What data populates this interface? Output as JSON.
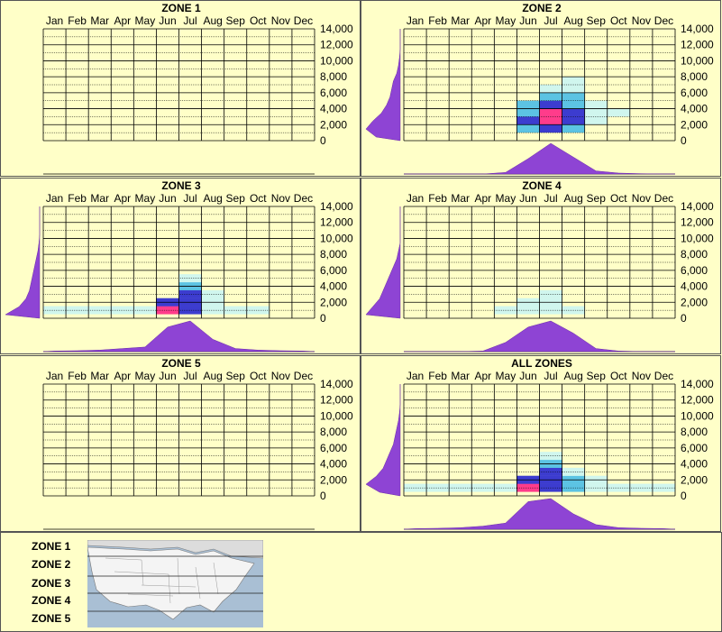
{
  "months": [
    "Jan",
    "Feb",
    "Mar",
    "Apr",
    "May",
    "Jun",
    "Jul",
    "Aug",
    "Sep",
    "Oct",
    "Nov",
    "Dec"
  ],
  "yticks": [
    "14,000",
    "12,000",
    "10,000",
    "8,000",
    "6,000",
    "4,000",
    "2,000",
    "0"
  ],
  "colors": {
    "background": "#ffffc8",
    "profile": "#8e44d4",
    "heat_low": "#c8f5f5",
    "heat_mid": "#40b8e8",
    "heat_high": "#1a1ad0",
    "heat_peak": "#ff1a80"
  },
  "chart_data": [
    {
      "type": "heatmap",
      "title": "ZONE 1",
      "x": [
        "Jan",
        "Feb",
        "Mar",
        "Apr",
        "May",
        "Jun",
        "Jul",
        "Aug",
        "Sep",
        "Oct",
        "Nov",
        "Dec"
      ],
      "ylim": [
        0,
        14000
      ],
      "cells": [],
      "month_profile": [
        0,
        0,
        0,
        0,
        0,
        0,
        0,
        0,
        0,
        0,
        0,
        0
      ],
      "elev_profile": [
        0,
        0,
        0,
        0,
        0,
        0,
        0,
        0,
        0,
        0,
        0,
        0,
        0,
        0
      ]
    },
    {
      "type": "heatmap",
      "title": "ZONE 2",
      "x": [
        "Jan",
        "Feb",
        "Mar",
        "Apr",
        "May",
        "Jun",
        "Jul",
        "Aug",
        "Sep",
        "Oct",
        "Nov",
        "Dec"
      ],
      "ylim": [
        0,
        14000
      ],
      "cells": [
        [
          5,
          1000,
          0.5
        ],
        [
          5,
          2000,
          0.7
        ],
        [
          5,
          3000,
          0.6
        ],
        [
          5,
          4000,
          0.4
        ],
        [
          6,
          1000,
          0.9
        ],
        [
          6,
          2000,
          1.0
        ],
        [
          6,
          3000,
          0.95
        ],
        [
          6,
          4000,
          0.7
        ],
        [
          6,
          5000,
          0.5
        ],
        [
          6,
          6000,
          0.3
        ],
        [
          7,
          1000,
          0.6
        ],
        [
          7,
          2000,
          0.8
        ],
        [
          7,
          3000,
          0.75
        ],
        [
          7,
          4000,
          0.6
        ],
        [
          7,
          5000,
          0.4
        ],
        [
          7,
          6000,
          0.3
        ],
        [
          7,
          7000,
          0.2
        ],
        [
          8,
          2000,
          0.25
        ],
        [
          8,
          3000,
          0.25
        ],
        [
          8,
          4000,
          0.2
        ],
        [
          9,
          3000,
          0.1
        ]
      ],
      "month_profile": [
        0,
        0,
        0,
        0,
        0.05,
        0.5,
        1.0,
        0.55,
        0.1,
        0.03,
        0.01,
        0
      ],
      "elev_profile": [
        0.7,
        1.0,
        0.8,
        0.55,
        0.4,
        0.3,
        0.25,
        0.2,
        0.1,
        0.05,
        0.02,
        0,
        0,
        0
      ]
    },
    {
      "type": "heatmap",
      "title": "ZONE 3",
      "x": [
        "Jan",
        "Feb",
        "Mar",
        "Apr",
        "May",
        "Jun",
        "Jul",
        "Aug",
        "Sep",
        "Oct",
        "Nov",
        "Dec"
      ],
      "ylim": [
        0,
        14000
      ],
      "cells": [
        [
          0,
          500,
          0.1
        ],
        [
          1,
          500,
          0.1
        ],
        [
          2,
          500,
          0.1
        ],
        [
          3,
          500,
          0.12
        ],
        [
          4,
          500,
          0.2
        ],
        [
          5,
          500,
          1.0
        ],
        [
          5,
          1500,
          0.7
        ],
        [
          6,
          500,
          0.7
        ],
        [
          6,
          1500,
          0.8
        ],
        [
          6,
          2500,
          0.7
        ],
        [
          6,
          3500,
          0.5
        ],
        [
          6,
          4500,
          0.3
        ],
        [
          7,
          500,
          0.3
        ],
        [
          7,
          1500,
          0.3
        ],
        [
          7,
          2500,
          0.25
        ],
        [
          8,
          500,
          0.15
        ],
        [
          9,
          500,
          0.1
        ]
      ],
      "month_profile": [
        0.02,
        0.03,
        0.05,
        0.1,
        0.15,
        0.8,
        1.0,
        0.4,
        0.1,
        0.05,
        0.03,
        0.02
      ],
      "elev_profile": [
        1.0,
        0.6,
        0.4,
        0.3,
        0.25,
        0.2,
        0.15,
        0.1,
        0.05,
        0.02,
        0,
        0,
        0,
        0
      ]
    },
    {
      "type": "heatmap",
      "title": "ZONE 4",
      "x": [
        "Jan",
        "Feb",
        "Mar",
        "Apr",
        "May",
        "Jun",
        "Jul",
        "Aug",
        "Sep",
        "Oct",
        "Nov",
        "Dec"
      ],
      "ylim": [
        0,
        14000
      ],
      "cells": [
        [
          4,
          500,
          0.08
        ],
        [
          5,
          500,
          0.12
        ],
        [
          5,
          1500,
          0.1
        ],
        [
          6,
          500,
          0.15
        ],
        [
          6,
          1500,
          0.12
        ],
        [
          6,
          2500,
          0.1
        ],
        [
          7,
          500,
          0.1
        ]
      ],
      "month_profile": [
        0,
        0,
        0,
        0.02,
        0.3,
        0.8,
        1.0,
        0.6,
        0.1,
        0.02,
        0,
        0
      ],
      "elev_profile": [
        1.0,
        0.8,
        0.6,
        0.5,
        0.4,
        0.3,
        0.2,
        0.1,
        0.05,
        0,
        0,
        0,
        0,
        0
      ]
    },
    {
      "type": "heatmap",
      "title": "ZONE 5",
      "x": [
        "Jan",
        "Feb",
        "Mar",
        "Apr",
        "May",
        "Jun",
        "Jul",
        "Aug",
        "Sep",
        "Oct",
        "Nov",
        "Dec"
      ],
      "ylim": [
        0,
        14000
      ],
      "cells": [],
      "month_profile": [
        0,
        0,
        0,
        0,
        0,
        0,
        0,
        0,
        0,
        0,
        0,
        0
      ],
      "elev_profile": [
        0,
        0,
        0,
        0,
        0,
        0,
        0,
        0,
        0,
        0,
        0,
        0,
        0,
        0
      ]
    },
    {
      "type": "heatmap",
      "title": "ALL ZONES",
      "x": [
        "Jan",
        "Feb",
        "Mar",
        "Apr",
        "May",
        "Jun",
        "Jul",
        "Aug",
        "Sep",
        "Oct",
        "Nov",
        "Dec"
      ],
      "ylim": [
        0,
        14000
      ],
      "cells": [
        [
          0,
          500,
          0.1
        ],
        [
          1,
          500,
          0.1
        ],
        [
          2,
          500,
          0.12
        ],
        [
          3,
          500,
          0.15
        ],
        [
          4,
          500,
          0.3
        ],
        [
          5,
          500,
          1.0
        ],
        [
          5,
          1500,
          0.7
        ],
        [
          6,
          500,
          0.8
        ],
        [
          6,
          1500,
          0.85
        ],
        [
          6,
          2500,
          0.7
        ],
        [
          6,
          3500,
          0.5
        ],
        [
          6,
          4500,
          0.3
        ],
        [
          7,
          500,
          0.4
        ],
        [
          7,
          1500,
          0.4
        ],
        [
          7,
          2500,
          0.3
        ],
        [
          8,
          500,
          0.2
        ],
        [
          8,
          1500,
          0.15
        ],
        [
          9,
          500,
          0.1
        ],
        [
          10,
          500,
          0.1
        ],
        [
          11,
          500,
          0.1
        ]
      ],
      "month_profile": [
        0.02,
        0.03,
        0.05,
        0.1,
        0.2,
        0.9,
        1.0,
        0.5,
        0.15,
        0.05,
        0.03,
        0.02
      ],
      "elev_profile": [
        0.6,
        1.0,
        0.7,
        0.5,
        0.4,
        0.3,
        0.2,
        0.15,
        0.1,
        0.05,
        0.02,
        0,
        0,
        0
      ]
    }
  ],
  "legend": {
    "zones": [
      "ZONE 1",
      "ZONE 2",
      "ZONE 3",
      "ZONE 4",
      "ZONE 5"
    ]
  }
}
